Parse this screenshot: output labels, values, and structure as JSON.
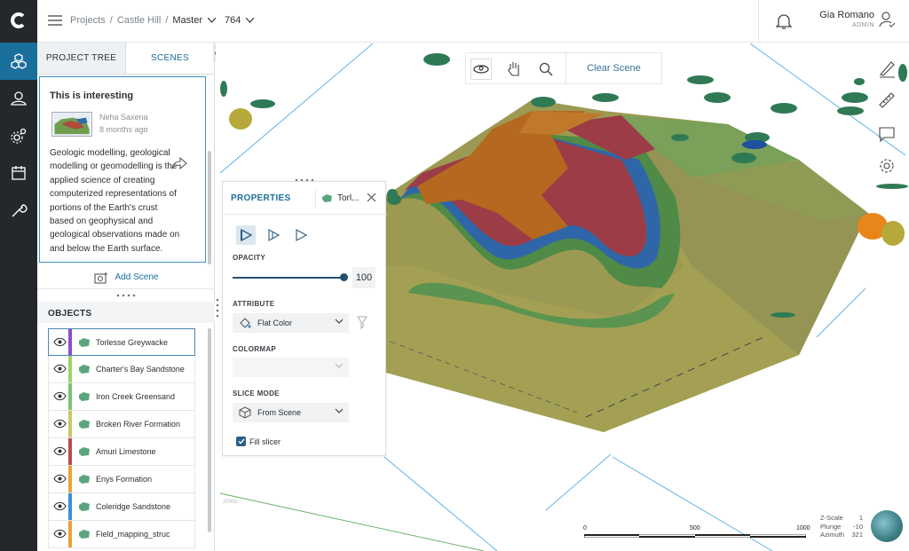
{
  "breadcrumb": {
    "projects": "Projects",
    "project": "Castle Hill",
    "branch": "Master",
    "revision": "764"
  },
  "user": {
    "name": "Gia Romano",
    "role": "ADMIN"
  },
  "panel": {
    "tabs": [
      "PROJECT TREE",
      "SCENES"
    ],
    "card": {
      "title": "This is interesting",
      "author": "Neha Saxena",
      "time": "8 months ago",
      "body": "Geologic modelling, geological modelling or geomodelling is the applied science of creating computerized representations of portions of the Earth's crust based on geophysical and geological observations made on and below the Earth surface."
    },
    "add_scene": "Add Scene",
    "objects_label": "OBJECTS",
    "objects": [
      {
        "label": "Torlesse Greywacke",
        "color": "#8a4fc7"
      },
      {
        "label": "Charter's Bay Sandstone",
        "color": "#9bd36b"
      },
      {
        "label": "Iron Creek Greensand",
        "color": "#7cc46d"
      },
      {
        "label": "Broken River Formation",
        "color": "#c5c86a"
      },
      {
        "label": "Amuri Limestone",
        "color": "#b94a55"
      },
      {
        "label": "Enys Formation",
        "color": "#e6a33a"
      },
      {
        "label": "Coleridge Sandstone",
        "color": "#3a8fd6"
      },
      {
        "label": "Field_mapping_struc",
        "color": "#e6a33a"
      }
    ]
  },
  "toolbar": {
    "clear_scene": "Clear Scene"
  },
  "properties": {
    "title": "PROPERTIES",
    "object": "Torl...",
    "opacity_label": "OPACITY",
    "opacity_value": "100",
    "attribute_label": "ATTRIBUTE",
    "attribute_value": "Flat Color",
    "colormap_label": "COLORMAP",
    "colormap_value": "",
    "slice_label": "SLICE MODE",
    "slice_value": "From Scene",
    "fill_slicer": "Fill slicer",
    "fill_slicer_checked": true
  },
  "scale": {
    "ticks": [
      "0",
      "500",
      "1000"
    ]
  },
  "view_info": {
    "zscale_label": "Z-Scale",
    "zscale": "1",
    "plunge_label": "Plunge",
    "plunge": "-10",
    "azimuth_label": "Azimuth",
    "azimuth": "321"
  },
  "coord_label": "20000"
}
